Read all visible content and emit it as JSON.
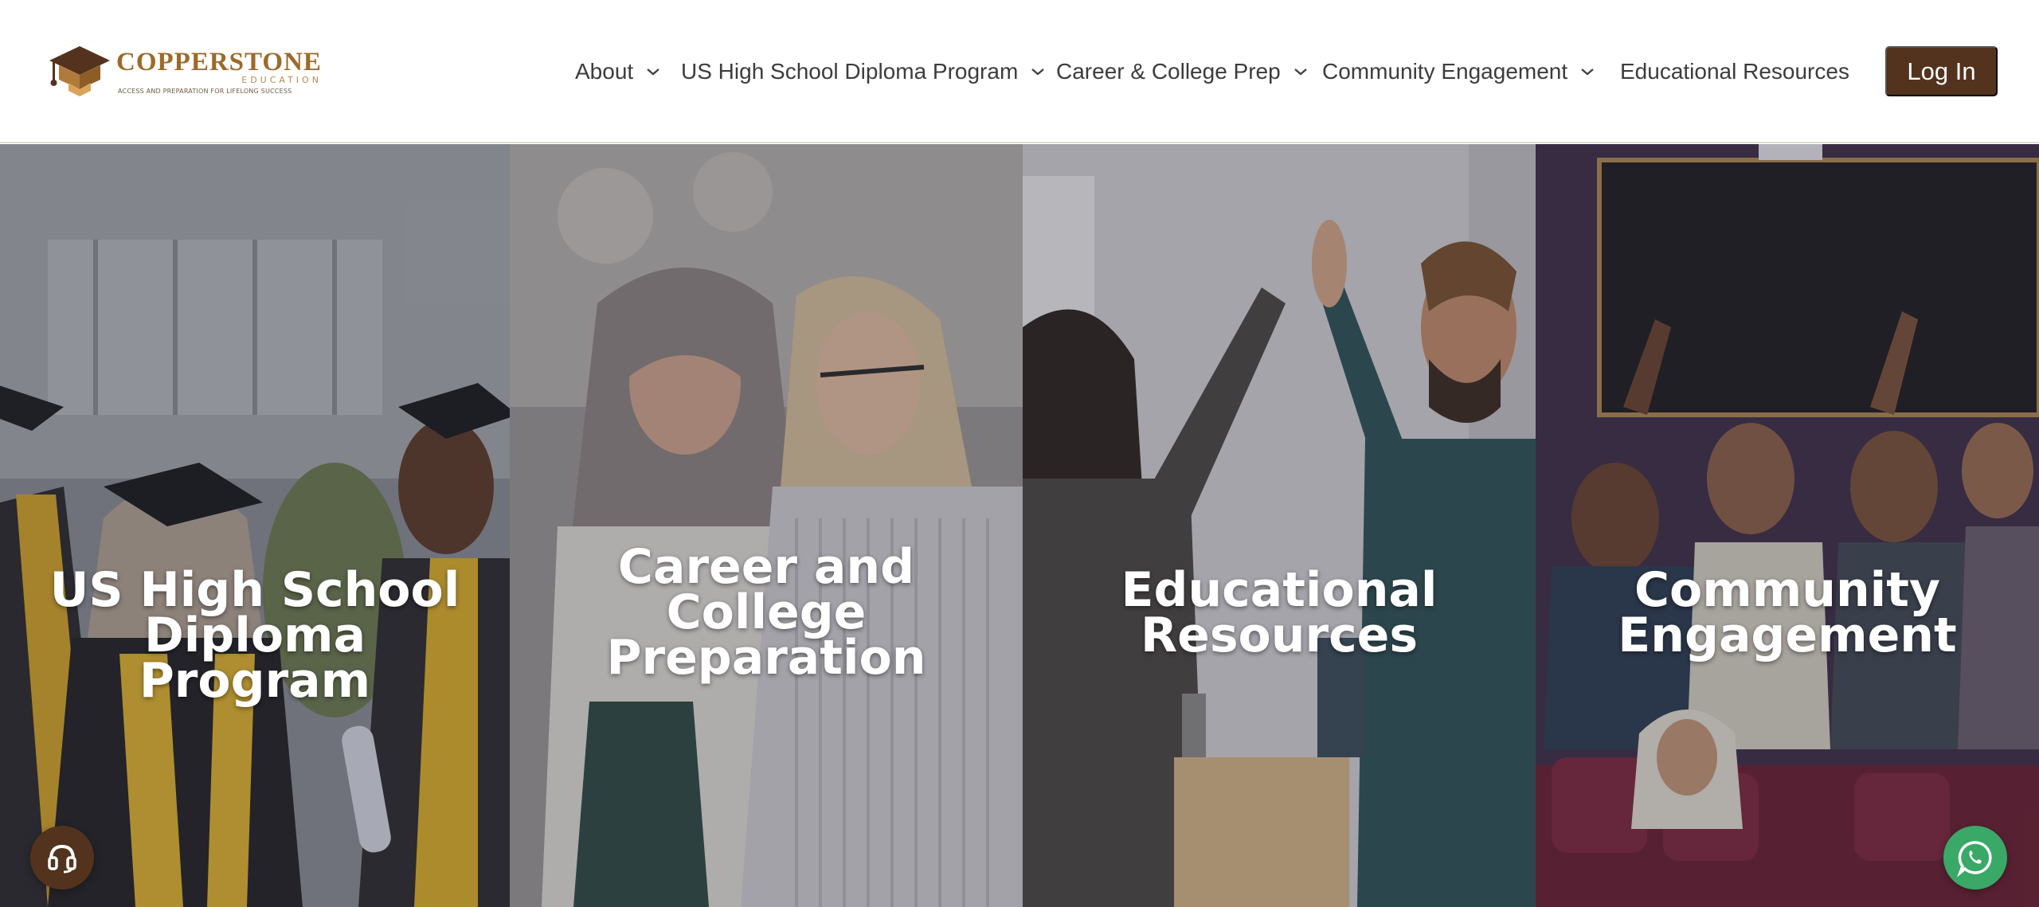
{
  "brand": {
    "name": "COPPERSTONE",
    "sub": "EDUCATION",
    "tagline": "ACCESS AND PREPARATION FOR LIFELONG SUCCESS",
    "colors": {
      "primary": "#53331e",
      "gold": "#9b6a2c",
      "whatsapp": "#3aa866"
    }
  },
  "nav": {
    "items": [
      {
        "label": "About",
        "has_dropdown": true
      },
      {
        "label": "US High School Diploma Program",
        "has_dropdown": true
      },
      {
        "label": "Career & College Prep",
        "has_dropdown": true
      },
      {
        "label": "Community Engagement",
        "has_dropdown": true
      },
      {
        "label": "Educational Resources",
        "has_dropdown": false
      }
    ],
    "login_label": "Log In"
  },
  "panels": [
    {
      "title_lines": [
        "US High School",
        "Diploma Program"
      ]
    },
    {
      "title_lines": [
        "Career and",
        "College",
        "Preparation"
      ]
    },
    {
      "title_lines": [
        "Educational",
        "Resources"
      ]
    },
    {
      "title_lines": [
        "Community",
        "Engagement"
      ]
    }
  ],
  "floating": {
    "support_icon": "headset-icon",
    "whatsapp_icon": "whatsapp-icon"
  }
}
